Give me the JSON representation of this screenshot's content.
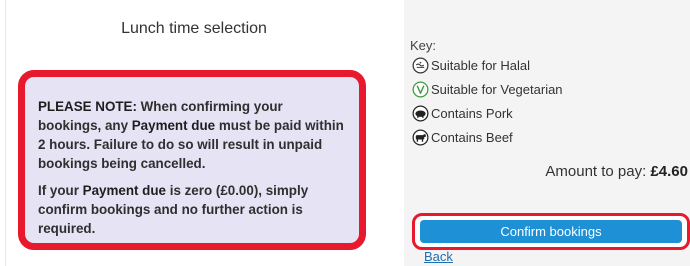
{
  "left": {
    "title": "Lunch time selection",
    "note": {
      "p1_prefix": "PLEASE NOTE:",
      "p1_a": " When confirming your bookings, any ",
      "p1_bold": "Payment due",
      "p1_b": " must be paid within 2 hours. Failure to do so will result in unpaid bookings being cancelled.",
      "p2_a": "If your ",
      "p2_bold": "Payment due",
      "p2_b": " is zero (£0.00), simply confirm bookings and no further action is required."
    },
    "highlight_color": "#e8192c"
  },
  "right": {
    "key_label": "Key:",
    "key_items": [
      {
        "icon": "halal-icon",
        "label": "Suitable for Halal"
      },
      {
        "icon": "vegetarian-icon",
        "label": "Suitable for Vegetarian"
      },
      {
        "icon": "pork-icon",
        "label": "Contains Pork"
      },
      {
        "icon": "beef-icon",
        "label": "Contains Beef"
      }
    ],
    "amount_label": "Amount to pay: ",
    "amount_value": "£4.60",
    "confirm_label": "Confirm bookings",
    "confirm_color": "#1e90d6",
    "back_label": "Back"
  }
}
